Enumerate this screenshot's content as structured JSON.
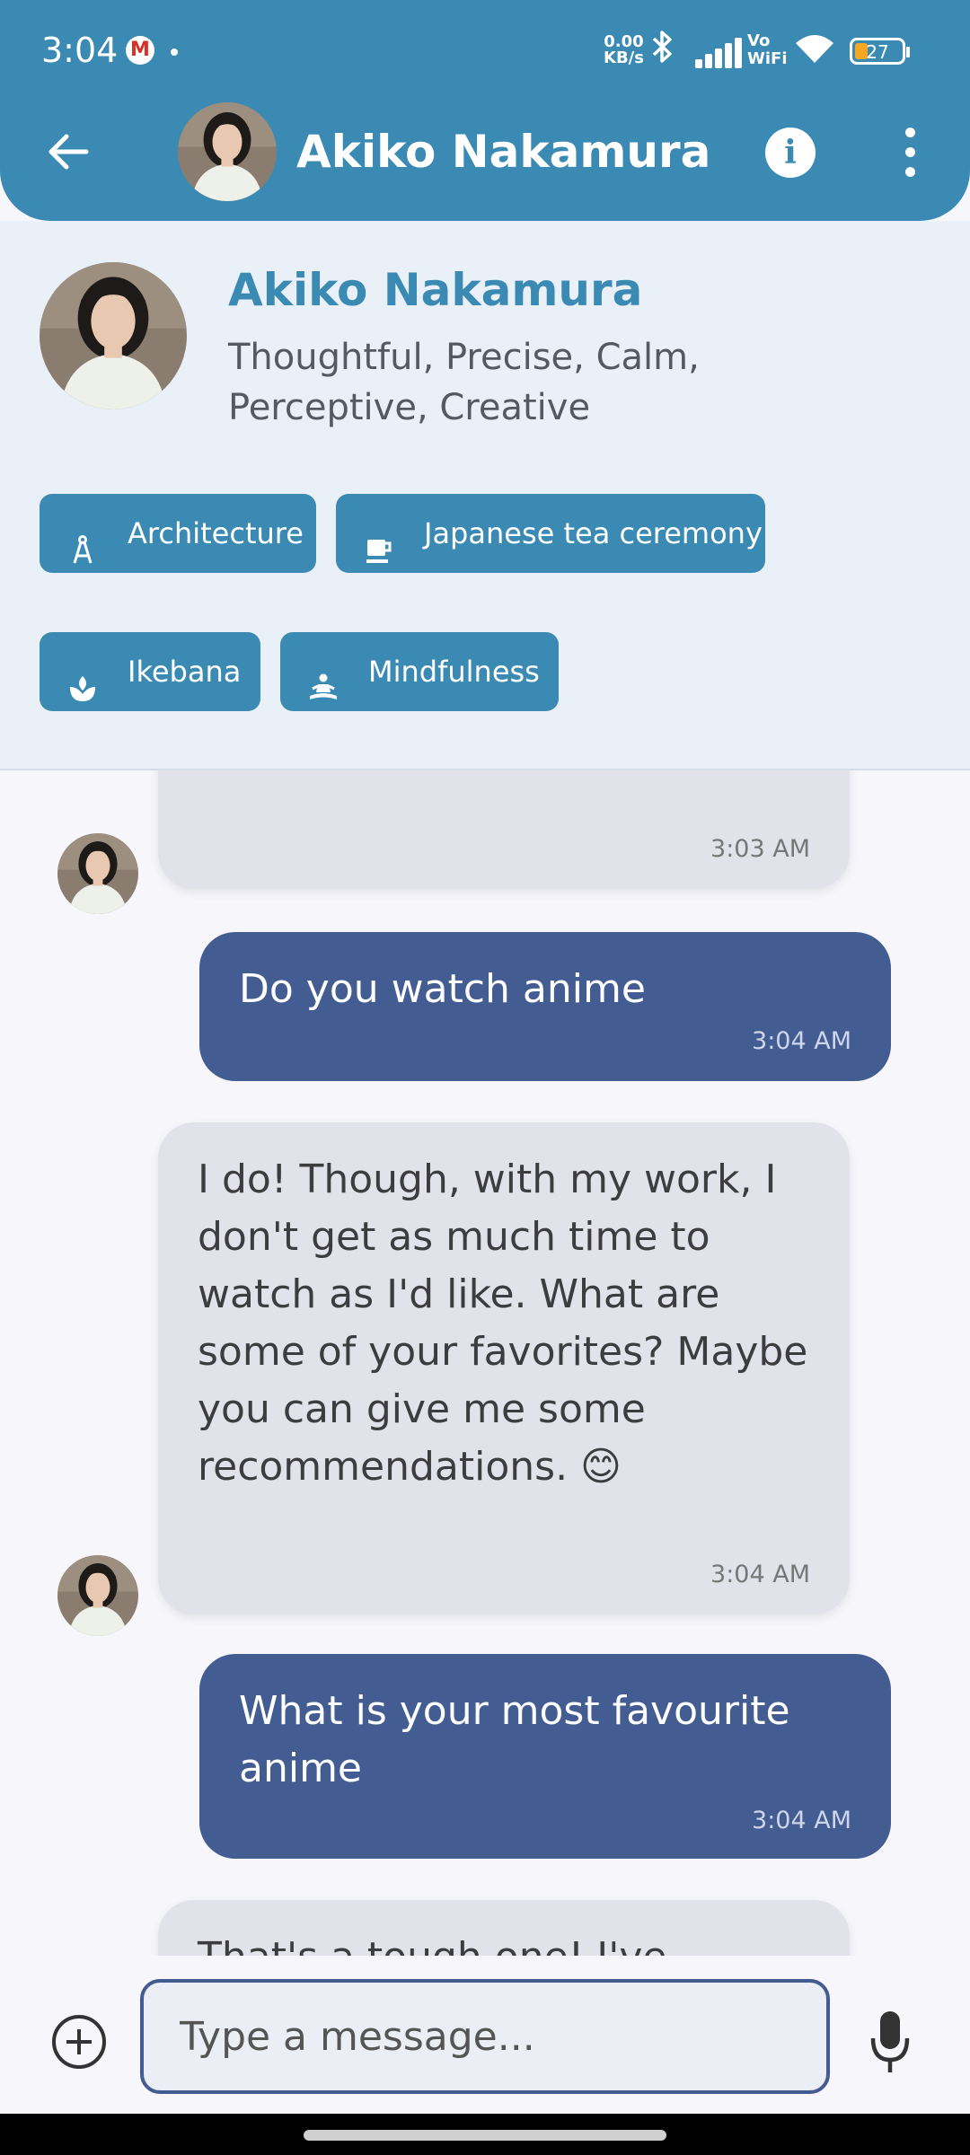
{
  "status_bar": {
    "time": "3:04",
    "net_speed_value": "0.00",
    "net_speed_unit": "KB/s",
    "vowifi_top": "Vo",
    "vowifi_bottom": "WiFi",
    "battery": "27"
  },
  "header": {
    "contact_name": "Akiko Nakamura"
  },
  "profile": {
    "name": "Akiko Nakamura",
    "traits": "Thoughtful, Precise, Calm, Perceptive, Creative",
    "interests": [
      {
        "label": "Architecture",
        "icon": "compass-icon"
      },
      {
        "label": "Japanese tea ceremony",
        "icon": "tea-cup-icon"
      },
      {
        "label": "Ikebana",
        "icon": "flower-icon"
      },
      {
        "label": "Mindfulness",
        "icon": "meditation-icon"
      }
    ]
  },
  "messages": [
    {
      "from": "contact",
      "text": "",
      "time": "3:03 AM"
    },
    {
      "from": "user",
      "text": "Do you watch anime",
      "time": "3:04 AM"
    },
    {
      "from": "contact",
      "text": "I do! Though, with my work, I don't get as much time to watch as I'd like. What are some of your favorites? Maybe you can give me some recommendations. 😊",
      "time": "3:04 AM"
    },
    {
      "from": "user",
      "text": "What is your most favourite anime",
      "time": "3:04 AM"
    },
    {
      "from": "contact",
      "text": "That's a tough one! I've",
      "time": ""
    }
  ],
  "composer": {
    "placeholder": "Type a message..."
  },
  "colors": {
    "primary": "#3b8ab3",
    "user_bubble": "#435c91",
    "contact_bubble": "#e2e2ea",
    "profile_bg": "#eaf0f8"
  }
}
